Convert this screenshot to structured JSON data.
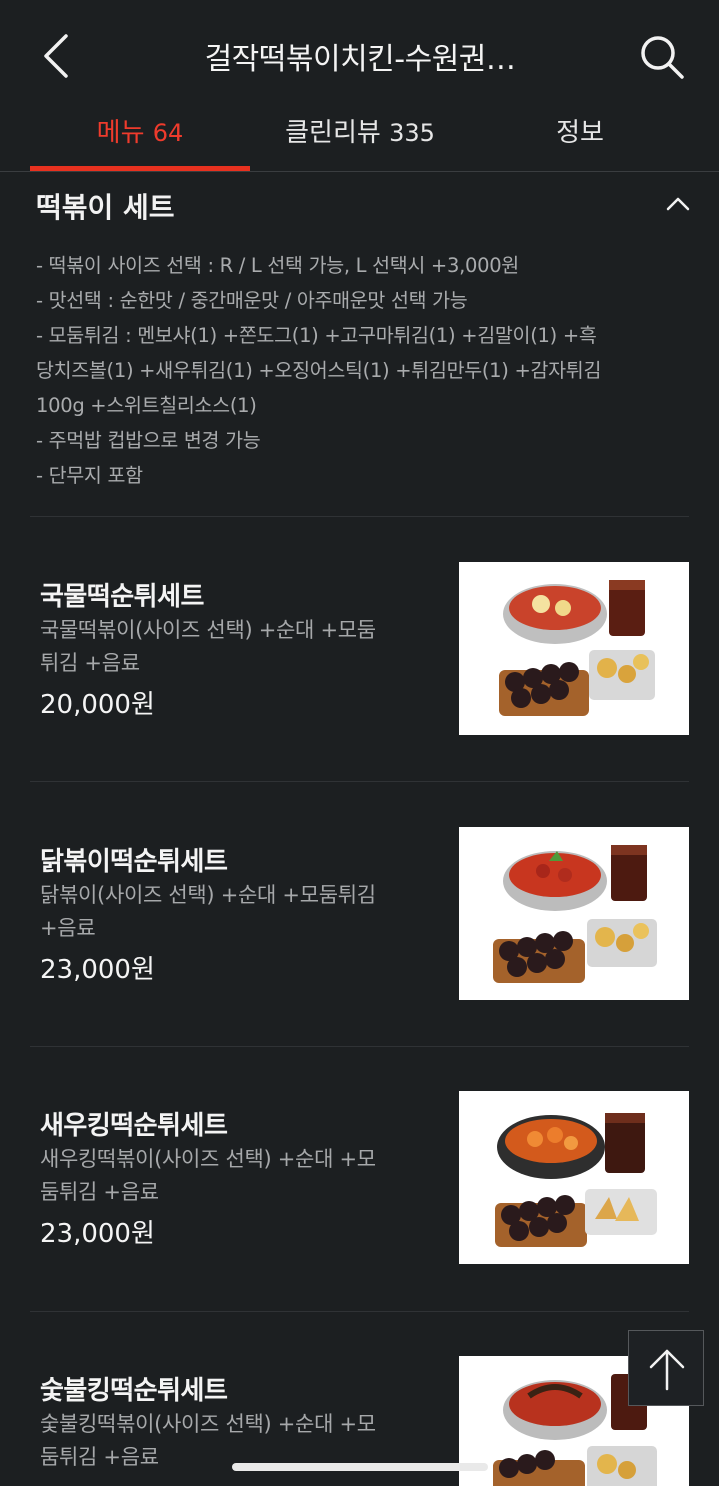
{
  "header": {
    "back_icon": "chevron-left-icon",
    "title": "걸작떡볶이치킨-수원권…",
    "search_icon": "search-icon"
  },
  "tabs": [
    {
      "label": "메뉴",
      "count": "64",
      "active": true
    },
    {
      "label": "클린리뷰",
      "count": "335",
      "active": false
    },
    {
      "label": "정보",
      "count": "",
      "active": false
    }
  ],
  "section": {
    "title": "떡볶이 세트",
    "collapse_icon": "chevron-up-icon",
    "description": [
      "- 떡볶이 사이즈 선택 : R / L 선택 가능, L 선택시 +3,000원",
      "- 맛선택 : 순한맛 / 중간매운맛 / 아주매운맛 선택 가능",
      "- 모둠튀김 : 멘보샤(1) +쫀도그(1) +고구마튀김(1) +김말이(1) +흑",
      "당치즈볼(1) +새우튀김(1) +오징어스틱(1) +튀김만두(1) +감자튀김",
      "100g +스위트칠리소스(1)",
      "- 주먹밥 컵밥으로 변경 가능",
      "- 단무지 포함"
    ]
  },
  "menu_items": [
    {
      "name": "국물떡순튀세트",
      "desc1": "국물떡볶이(사이즈 선택) +순대 +모둠",
      "desc2": "튀김 +음료",
      "price": "20,000원",
      "sauce": "#c9432b"
    },
    {
      "name": "닭볶이떡순튀세트",
      "desc1": "닭볶이(사이즈 선택) +순대 +모둠튀김",
      "desc2": "+음료",
      "price": "23,000원",
      "sauce": "#c8361f"
    },
    {
      "name": "새우킹떡순튀세트",
      "desc1": "새우킹떡볶이(사이즈 선택) +순대 +모",
      "desc2": "둠튀김 +음료",
      "price": "23,000원",
      "sauce": "#d35a1c"
    },
    {
      "name": "숯불킹떡순튀세트",
      "desc1": "숯불킹떡볶이(사이즈 선택) +순대 +모",
      "desc2": "둠튀김 +음료",
      "price": "",
      "sauce": "#b8321e"
    }
  ],
  "scroll_top_icon": "arrow-up-icon",
  "colors": {
    "background": "#1c1f21",
    "accent": "#e8311f",
    "text_primary": "#f4f4f4",
    "text_secondary": "#a9abad"
  }
}
